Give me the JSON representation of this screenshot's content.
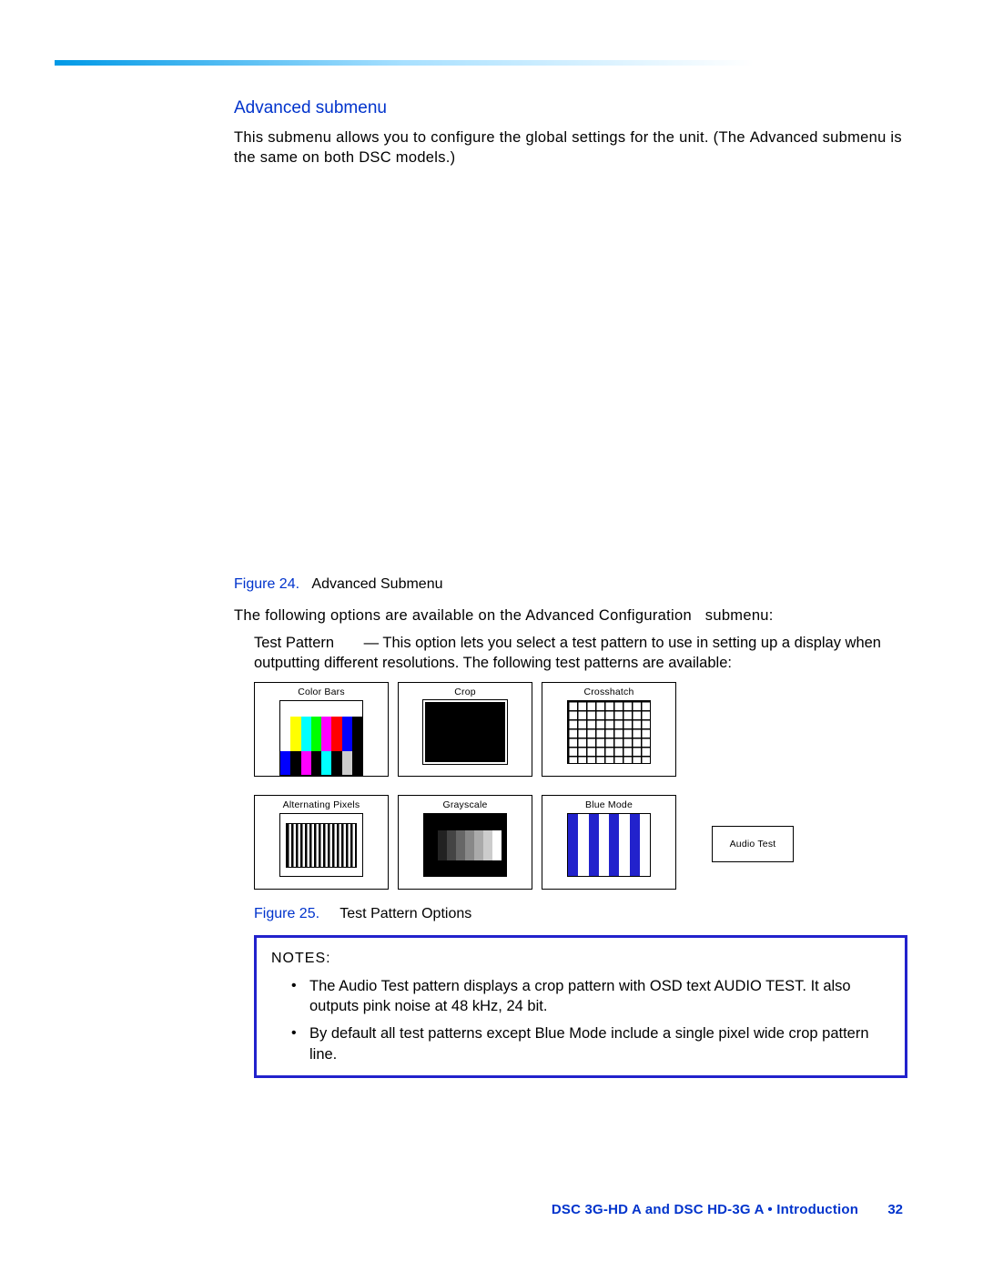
{
  "section": {
    "heading": "Advanced submenu",
    "intro_1": "This submenu allows you to configure the global settings for the unit. (The ",
    "intro_code": "Advanced",
    "intro_2": " submenu is the same on both DSC models.)"
  },
  "fig24": {
    "label": "Figure 24.",
    "caption": "Advanced Submenu"
  },
  "options_intro_1": "The following options are available on the ",
  "options_intro_menu": "Advanced   Configuration",
  "options_intro_2": " submenu:",
  "test_pattern": {
    "name": "Test Pattern",
    "desc": " — This option lets you select a test pattern to use in setting up a display when outputting different resolutions. The following test patterns are available:"
  },
  "patterns": {
    "color_bars": "Color Bars",
    "crop": "Crop",
    "crosshatch": "Crosshatch",
    "alt_pixels": "Alternating Pixels",
    "grayscale": "Grayscale",
    "blue_mode": "Blue Mode",
    "audio_test": "Audio Test"
  },
  "fig25": {
    "label": "Figure 25.",
    "caption": "Test Pattern Options"
  },
  "notes": {
    "heading": "NOTES:",
    "n1_a": "The Audio Test pattern displays a crop pattern with OSD text ",
    "n1_code": "AUDIO TEST",
    "n1_b": ". It also outputs pink noise at 48 kHz, 24 bit.",
    "n2": "By default all test patterns except Blue Mode include a single pixel wide crop pattern line."
  },
  "footer": {
    "text": "DSC 3G-HD A and DSC HD-3G A • Introduction",
    "page": "32"
  }
}
